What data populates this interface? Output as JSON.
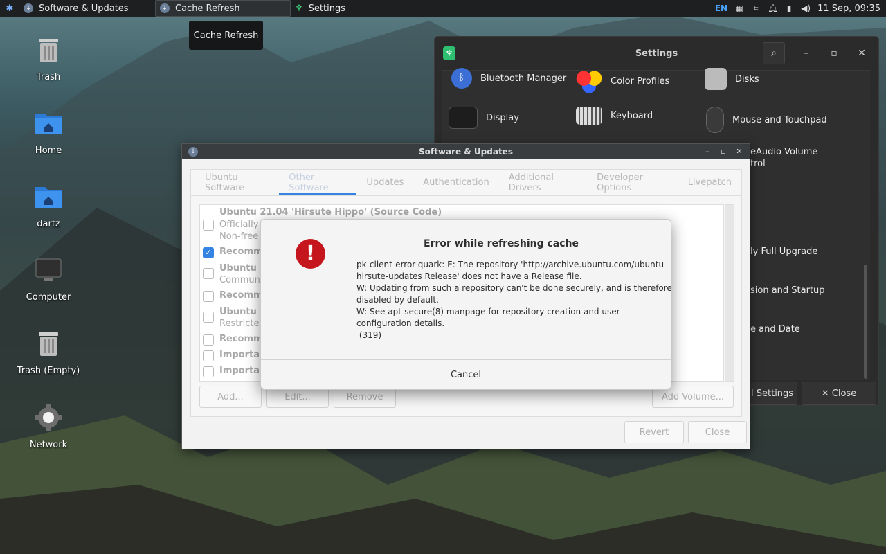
{
  "panel": {
    "tasks": [
      {
        "label": "Software & Updates"
      },
      {
        "label": "Cache Refresh"
      },
      {
        "label": "Settings"
      }
    ],
    "lang": "EN",
    "clock": "11 Sep, 09:35"
  },
  "tooltip": "Cache Refresh",
  "desktop": {
    "icons": [
      {
        "label": "Trash"
      },
      {
        "label": "Home"
      },
      {
        "label": "dartz"
      },
      {
        "label": "Computer"
      },
      {
        "label": "Trash (Empty)"
      },
      {
        "label": "Network"
      }
    ]
  },
  "settings": {
    "title": "Settings",
    "items": [
      {
        "label": "Bluetooth Manager"
      },
      {
        "label": "Color Profiles"
      },
      {
        "label": "Disks"
      },
      {
        "label": "Display"
      },
      {
        "label": "Keyboard"
      },
      {
        "label": "Mouse and Touchpad"
      },
      {
        "label": "eAudio Volume"
      },
      {
        "label": "trol"
      },
      {
        "label": "ly Full Upgrade"
      },
      {
        "label": "sion and Startup"
      },
      {
        "label": "e and Date"
      }
    ],
    "footer": {
      "all_settings": "l Settings",
      "close": "✕ Close"
    }
  },
  "software_updates": {
    "title": "Software & Updates",
    "tabs": [
      "Ubuntu Software",
      "Other Software",
      "Updates",
      "Authentication",
      "Additional Drivers",
      "Developer Options",
      "Livepatch"
    ],
    "rows": [
      {
        "text": "Ubuntu 21.04 'Hirsute Hippo' (Source Code)",
        "checked": false,
        "bold": true,
        "nocb": true
      },
      {
        "text": "Officially su",
        "sub": "Non-free d",
        "checked": false
      },
      {
        "text": "Recommen",
        "checked": true
      },
      {
        "text": "Ubuntu 21",
        "sub": "Community",
        "checked": false
      },
      {
        "text": "Recommen",
        "checked": false
      },
      {
        "text": "Ubuntu 21",
        "sub": "Restricted",
        "checked": false
      },
      {
        "text": "Recommen",
        "checked": false
      },
      {
        "text": "Important",
        "checked": false
      },
      {
        "text": "Important",
        "checked": false
      }
    ],
    "buttons": {
      "add": "Add...",
      "edit": "Edit...",
      "remove": "Remove",
      "add_volume": "Add Volume...",
      "revert": "Revert",
      "close": "Close"
    }
  },
  "dialog": {
    "title": "Error while refreshing cache",
    "message": [
      "pk-client-error-quark: E: The repository 'http://archive.ubuntu.com/ubuntu",
      "hirsute-updates Release' does not have a Release file.",
      "W: Updating from such a repository can't be done securely, and is therefore",
      "disabled by default.",
      "W: See apt-secure(8) manpage for repository creation and user",
      "configuration details.",
      " (319)"
    ],
    "cancel": "Cancel"
  },
  "colors": {
    "accent": "#3584e4",
    "error": "#c4161c",
    "panel_bg": "#1d1f21"
  }
}
